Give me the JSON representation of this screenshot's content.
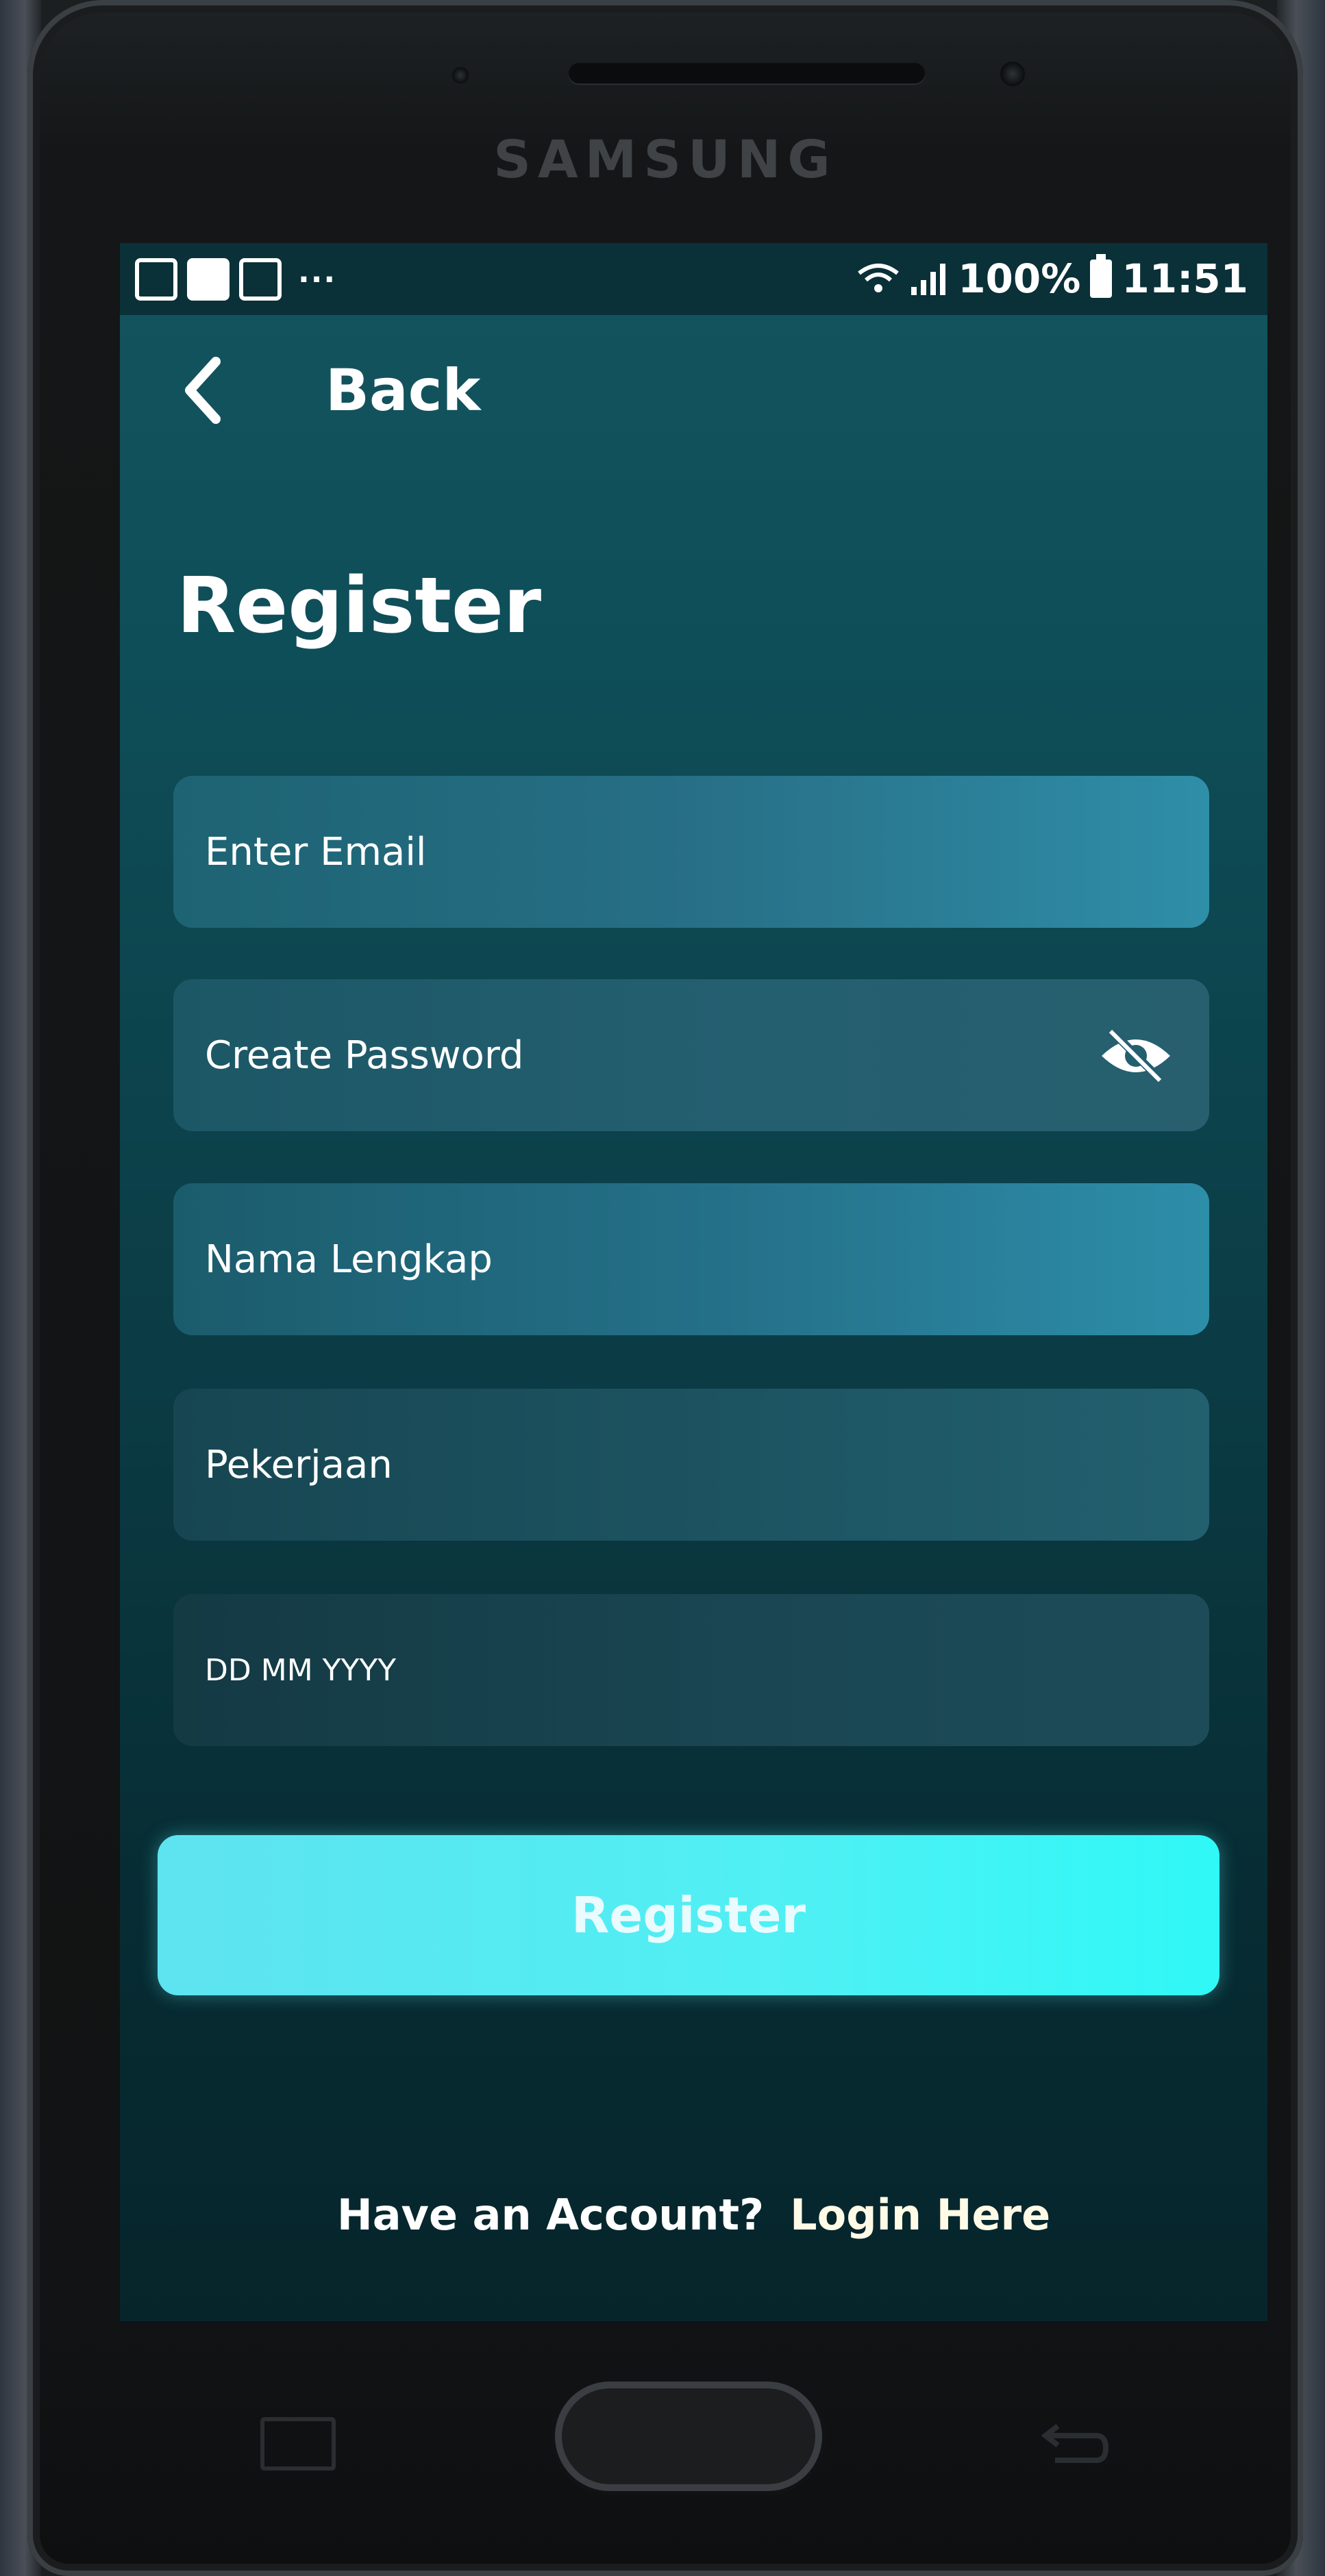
{
  "device": {
    "brand": "SAMSUNG"
  },
  "status_bar": {
    "notification_dots": "···",
    "battery": "100%",
    "time": "11:51"
  },
  "header": {
    "back_label": "Back"
  },
  "form": {
    "title": "Register",
    "fields": [
      {
        "placeholder": "Enter Email"
      },
      {
        "placeholder": "Create Password"
      },
      {
        "placeholder": "Nama Lengkap"
      },
      {
        "placeholder": "Pekerjaan"
      },
      {
        "placeholder": "DD MM YYYY"
      }
    ],
    "submit_label": "Register"
  },
  "footer": {
    "prompt": "Have an Account?",
    "link": "Login Here"
  },
  "colors": {
    "accent": "#4ff0f4",
    "screen_bg": "#0b3b44",
    "field_bg": "#276f86"
  }
}
